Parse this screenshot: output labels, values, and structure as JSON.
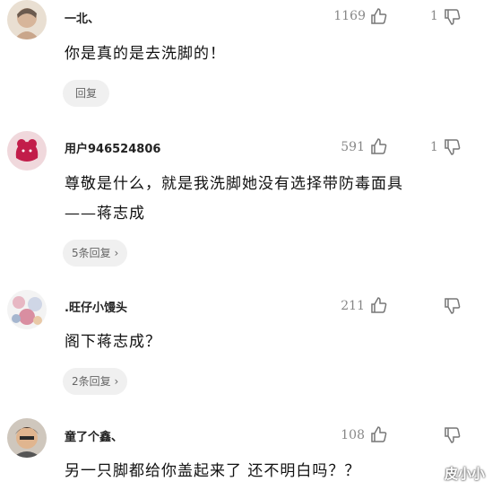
{
  "comments": [
    {
      "username": "一北、",
      "likes": "1169",
      "dislikes": "1",
      "content": [
        "你是真的是去洗脚的！"
      ],
      "reply_label": "回复"
    },
    {
      "username": "用户946524806",
      "likes": "591",
      "dislikes": "1",
      "content": [
        "尊敬是什么，就是我洗脚她没有选择带防毒面具",
        "——蒋志成"
      ],
      "reply_label": "5条回复 ›"
    },
    {
      "username": ".旺仔小馒头",
      "likes": "211",
      "dislikes": "",
      "content": [
        "阁下蒋志成？"
      ],
      "reply_label": "2条回复 ›"
    },
    {
      "username": "童了个鑫、",
      "likes": "108",
      "dislikes": "",
      "content": [
        "另一只脚都给你盖起来了 还不明白吗？？"
      ],
      "reply_label": ""
    }
  ],
  "watermark": "皮小小",
  "colors": {
    "text": "#111111",
    "meta": "#888888",
    "reply_bg": "#f0f0f0"
  },
  "icons": [
    "thumbs-up-icon",
    "thumbs-down-icon"
  ]
}
